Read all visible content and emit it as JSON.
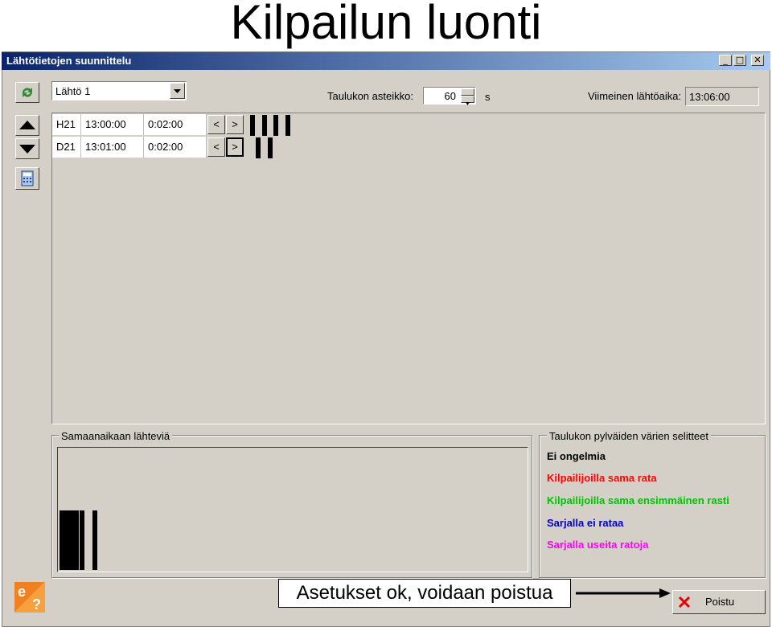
{
  "slide": {
    "title": "Kilpailun luonti"
  },
  "window": {
    "title": "Lähtötietojen suunnittelu",
    "buttons": {
      "minimize": "_",
      "maximize": "□",
      "close": "✕"
    }
  },
  "toolbar": {
    "start_select": "Lähtö 1",
    "scale_label": "Taulukon asteikko:",
    "scale_value": "60",
    "scale_unit": "s",
    "last_start_label": "Viimeinen lähtöaika:",
    "last_start_value": "13:06:00"
  },
  "table": {
    "rows": [
      {
        "class": "H21",
        "start": "13:00:00",
        "interval": "0:02:00",
        "bars": 4
      },
      {
        "class": "D21",
        "start": "13:01:00",
        "interval": "0:02:00",
        "bars": 2
      }
    ],
    "prev": "<",
    "next": ">"
  },
  "simultaneous": {
    "title": "Samaanaikaan lähteviä",
    "bars": 6
  },
  "legend": {
    "title": "Taulukon pylväiden värien selitteet",
    "items": [
      {
        "label": "Ei ongelmia",
        "color": "#000000"
      },
      {
        "label": "Kilpailijoilla sama rata",
        "color": "#ff0000"
      },
      {
        "label": "Kilpailijoilla sama ensimmäinen rasti",
        "color": "#00c000"
      },
      {
        "label": "Sarjalla ei rataa",
        "color": "#0000c0"
      },
      {
        "label": "Sarjalla useita ratoja",
        "color": "#ff00ff"
      }
    ]
  },
  "footer": {
    "callout": "Asetukset ok, voidaan poistua",
    "exit_label": "Poistu"
  },
  "icons": [
    "refresh-icon",
    "arrow-up-icon",
    "arrow-down-icon",
    "calculator-icon",
    "help-logo-icon",
    "close-x-icon"
  ]
}
